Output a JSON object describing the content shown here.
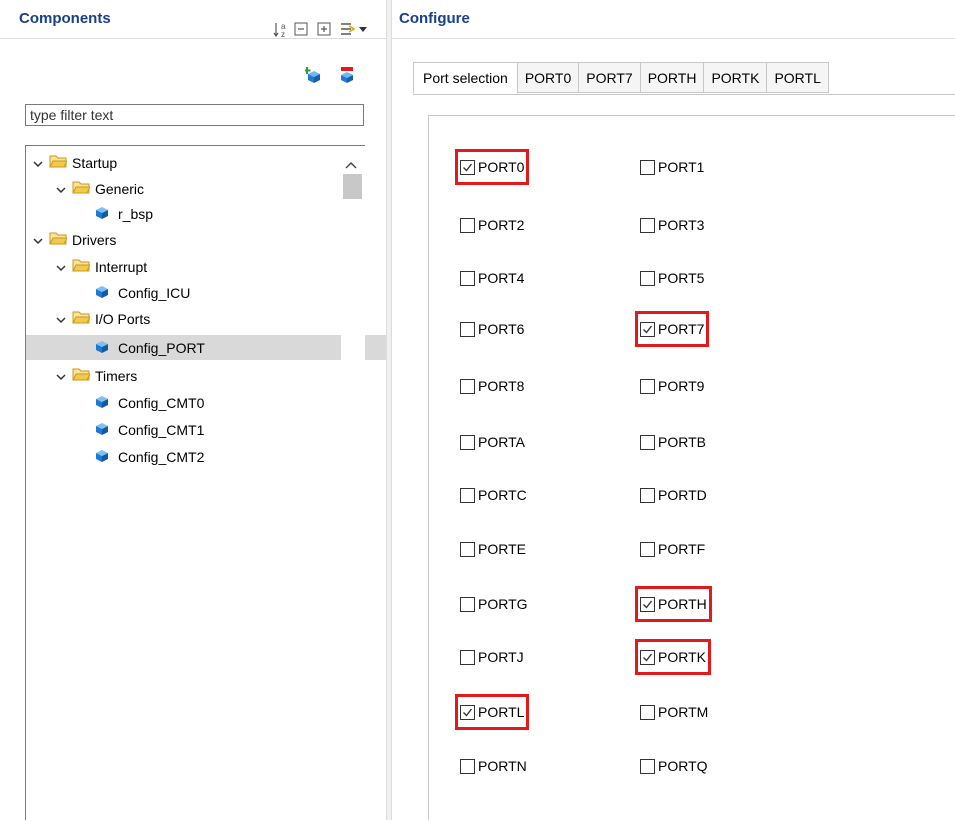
{
  "left": {
    "title": "Components",
    "filter_placeholder": "type filter text",
    "tree": [
      {
        "label": "Startup",
        "type": "folder"
      },
      {
        "label": "Generic",
        "type": "folder"
      },
      {
        "label": "r_bsp",
        "type": "component"
      },
      {
        "label": "Drivers",
        "type": "folder"
      },
      {
        "label": "Interrupt",
        "type": "folder"
      },
      {
        "label": "Config_ICU",
        "type": "component"
      },
      {
        "label": "I/O Ports",
        "type": "folder"
      },
      {
        "label": "Config_PORT",
        "type": "component",
        "selected": true
      },
      {
        "label": "Timers",
        "type": "folder"
      },
      {
        "label": "Config_CMT0",
        "type": "component"
      },
      {
        "label": "Config_CMT1",
        "type": "component"
      },
      {
        "label": "Config_CMT2",
        "type": "component"
      }
    ]
  },
  "right": {
    "title": "Configure",
    "tabs": [
      "Port selection",
      "PORT0",
      "PORT7",
      "PORTH",
      "PORTK",
      "PORTL"
    ],
    "active_tab": "Port selection",
    "ports": [
      {
        "label": "PORT0",
        "checked": true
      },
      {
        "label": "PORT1",
        "checked": false
      },
      {
        "label": "PORT2",
        "checked": false
      },
      {
        "label": "PORT3",
        "checked": false
      },
      {
        "label": "PORT4",
        "checked": false
      },
      {
        "label": "PORT5",
        "checked": false
      },
      {
        "label": "PORT6",
        "checked": false
      },
      {
        "label": "PORT7",
        "checked": true
      },
      {
        "label": "PORT8",
        "checked": false
      },
      {
        "label": "PORT9",
        "checked": false
      },
      {
        "label": "PORTA",
        "checked": false
      },
      {
        "label": "PORTB",
        "checked": false
      },
      {
        "label": "PORTC",
        "checked": false
      },
      {
        "label": "PORTD",
        "checked": false
      },
      {
        "label": "PORTE",
        "checked": false
      },
      {
        "label": "PORTF",
        "checked": false
      },
      {
        "label": "PORTG",
        "checked": false
      },
      {
        "label": "PORTH",
        "checked": true
      },
      {
        "label": "PORTJ",
        "checked": false
      },
      {
        "label": "PORTK",
        "checked": true
      },
      {
        "label": "PORTL",
        "checked": true
      },
      {
        "label": "PORTM",
        "checked": false
      },
      {
        "label": "PORTN",
        "checked": false
      },
      {
        "label": "PORTQ",
        "checked": false
      }
    ]
  },
  "colors": {
    "title_blue": "#1a3f8c",
    "highlight_red": "#e31a1c",
    "folder_yellow": "#f2c94c",
    "cube_blue": "#1f78d1",
    "selected_row": "#d9d9d9"
  }
}
